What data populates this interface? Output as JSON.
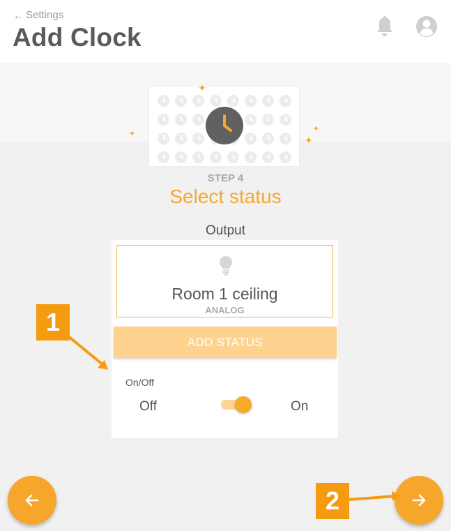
{
  "header": {
    "back_label": "Settings",
    "title": "Add Clock",
    "icons": [
      "bell-icon",
      "user-avatar-icon"
    ]
  },
  "wizard": {
    "step_label": "STEP 4",
    "step_title": "Select status"
  },
  "output": {
    "section_label": "Output",
    "device_name": "Room 1 ceiling",
    "device_type": "ANALOG",
    "icon": "lightbulb-icon"
  },
  "status": {
    "add_button_label": "ADD STATUS",
    "toggle_caption": "On/Off",
    "off_label": "Off",
    "on_label": "On",
    "toggle_state": "on"
  },
  "navigation": {
    "prev_icon": "arrow-left-icon",
    "next_icon": "arrow-right-icon"
  },
  "annotations": {
    "callout_1": "1",
    "callout_2": "2"
  },
  "colors": {
    "accent": "#f6a62a",
    "accent_light": "#fdd38f",
    "callout": "#f59b10",
    "title_text": "#5a5a5a"
  }
}
